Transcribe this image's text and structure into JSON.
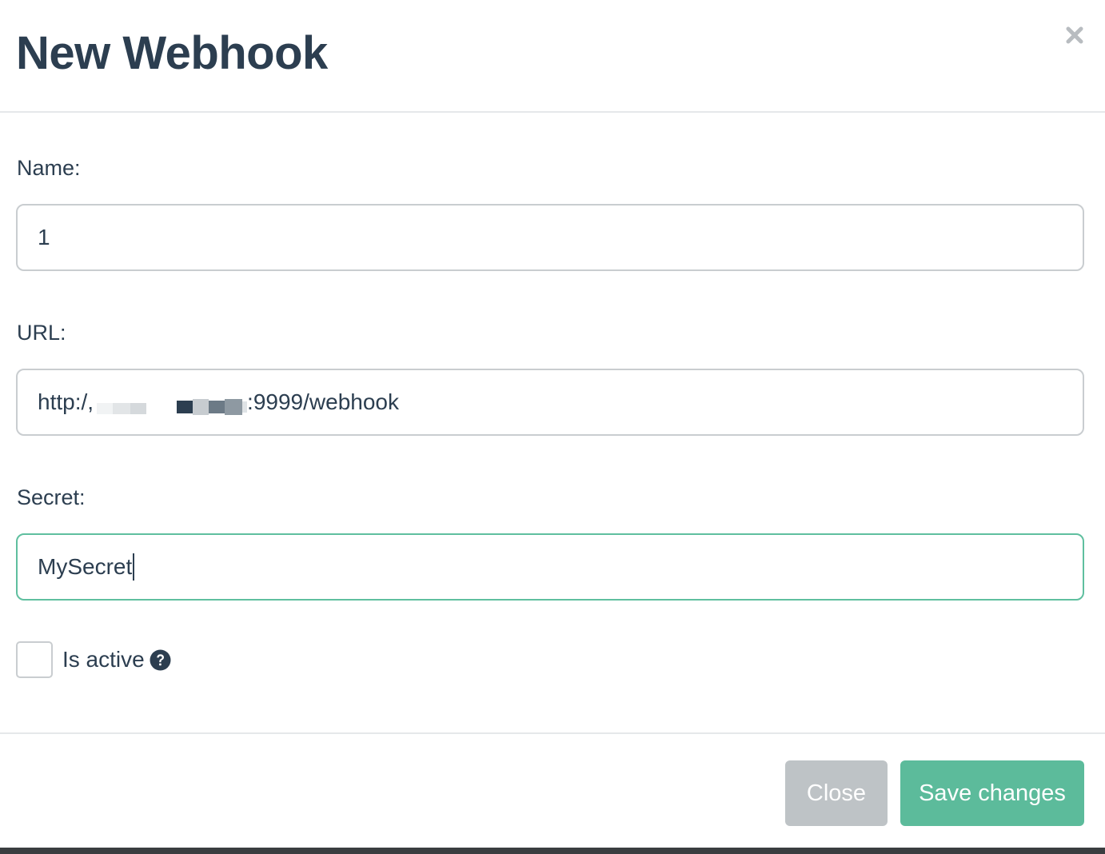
{
  "modal": {
    "title": "New Webhook"
  },
  "form": {
    "name": {
      "label": "Name:",
      "value": "1"
    },
    "url": {
      "label": "URL:",
      "prefix": "http:/,",
      "suffix": ":9999/webhook"
    },
    "secret": {
      "label": "Secret:",
      "value": "MySecret"
    },
    "is_active": {
      "label": "Is active",
      "checked": false
    }
  },
  "footer": {
    "close_label": "Close",
    "save_label": "Save changes"
  },
  "colors": {
    "title": "#2c3e50",
    "focus_border": "#5fbf9f",
    "save_button": "#5cbb9b",
    "close_button": "#bec3c6"
  },
  "icons": {
    "dismiss": "close-icon",
    "help": "question-circle-icon"
  }
}
